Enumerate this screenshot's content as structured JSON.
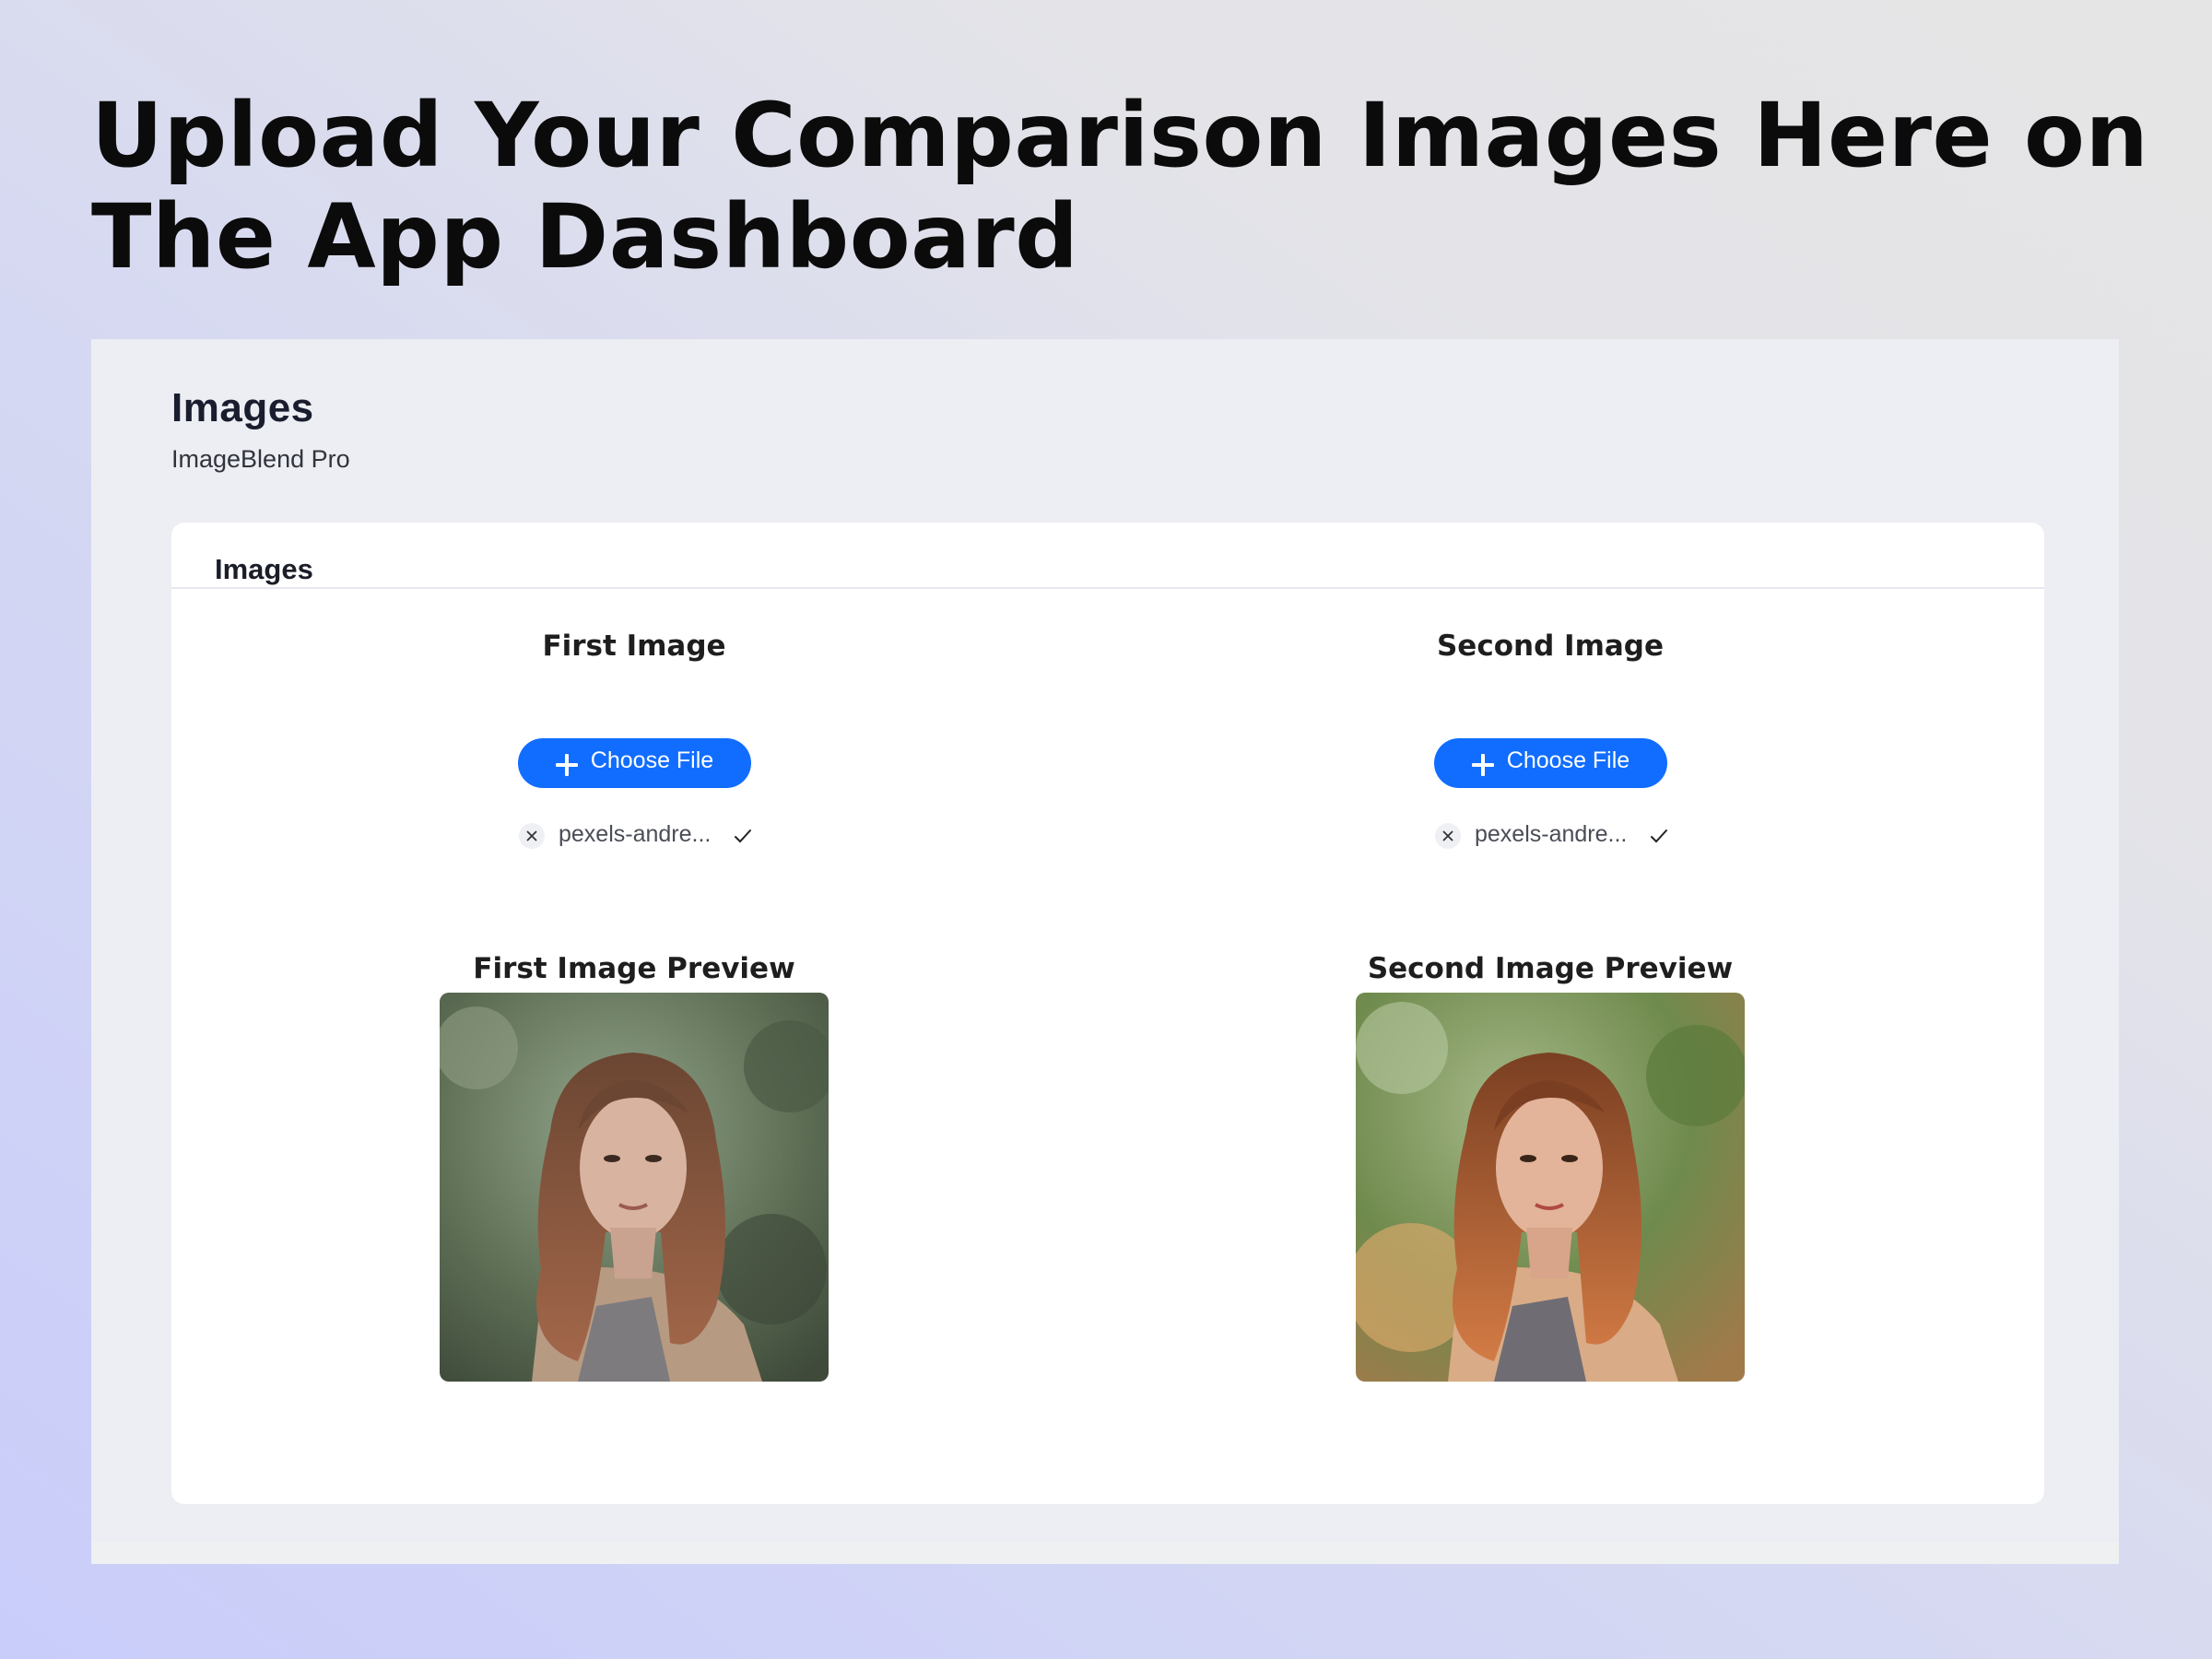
{
  "headline": "Upload Your Comparison Images Here on The App Dashboard",
  "page": {
    "title": "Images",
    "subtitle": "ImageBlend Pro"
  },
  "card": {
    "title": "Images",
    "columns": [
      {
        "heading": "First Image",
        "button_label": "Choose File",
        "filename": "pexels-andre...",
        "preview_heading": "First Image Preview"
      },
      {
        "heading": "Second Image",
        "button_label": "Choose File",
        "filename": "pexels-andre...",
        "preview_heading": "Second Image Preview"
      }
    ]
  },
  "colors": {
    "accent": "#116dff",
    "card_bg": "#ffffff",
    "dashboard_bg": "#eceef3"
  },
  "icons": [
    "plus-icon",
    "close-icon",
    "checkmark-icon"
  ]
}
